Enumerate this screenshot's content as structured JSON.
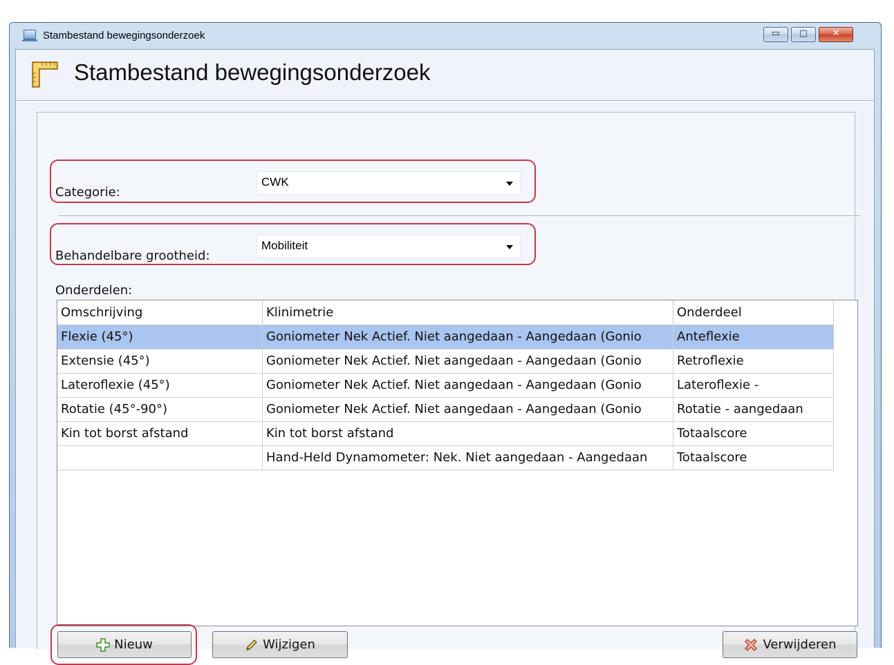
{
  "window": {
    "title": "Stambestand bewegingsonderzoek",
    "controls": {
      "minimize": "▭",
      "maximize": "▢",
      "close": "✕"
    }
  },
  "header": {
    "title": "Stambestand bewegingsonderzoek",
    "icon": "ruler-icon"
  },
  "form": {
    "categorie": {
      "label": "Categorie:",
      "value": "CWK"
    },
    "grootheid": {
      "label": "Behandelbare grootheid:",
      "value": "Mobiliteit"
    },
    "onderdelen_label": "Onderdelen:"
  },
  "table": {
    "columns": [
      "Omschrijving",
      "Klinimetrie",
      "Onderdeel"
    ],
    "rows": [
      {
        "omschrijving": "Flexie (45°)",
        "klinimetrie": "Goniometer Nek Actief. Niet aangedaan - Aangedaan (Gonio",
        "onderdeel": "Anteflexie",
        "selected": true
      },
      {
        "omschrijving": "Extensie (45°)",
        "klinimetrie": "Goniometer Nek Actief. Niet aangedaan - Aangedaan (Gonio",
        "onderdeel": "Retroflexie",
        "selected": false
      },
      {
        "omschrijving": "Lateroflexie (45°)",
        "klinimetrie": "Goniometer Nek Actief. Niet aangedaan - Aangedaan (Gonio",
        "onderdeel": "Lateroflexie -",
        "selected": false
      },
      {
        "omschrijving": "Rotatie (45°-90°)",
        "klinimetrie": "Goniometer Nek Actief. Niet aangedaan - Aangedaan (Gonio",
        "onderdeel": "Rotatie - aangedaan",
        "selected": false
      },
      {
        "omschrijving": "Kin tot borst afstand",
        "klinimetrie": "Kin tot borst afstand",
        "onderdeel": "Totaalscore",
        "selected": false
      },
      {
        "omschrijving": "",
        "klinimetrie": "Hand-Held Dynamometer: Nek. Niet aangedaan - Aangedaan",
        "onderdeel": "Totaalscore",
        "selected": false
      }
    ]
  },
  "buttons": {
    "nieuw": {
      "label": "Nieuw",
      "icon": "plus-icon"
    },
    "wijzigen": {
      "label": "Wijzigen",
      "icon": "pencil-icon"
    },
    "verwijderen": {
      "label": "Verwijderen",
      "icon": "delete-x-icon"
    }
  },
  "colors": {
    "selection": "#aac5f0",
    "highlight": "#c2394a",
    "window_frame": "#bdd3ea"
  }
}
